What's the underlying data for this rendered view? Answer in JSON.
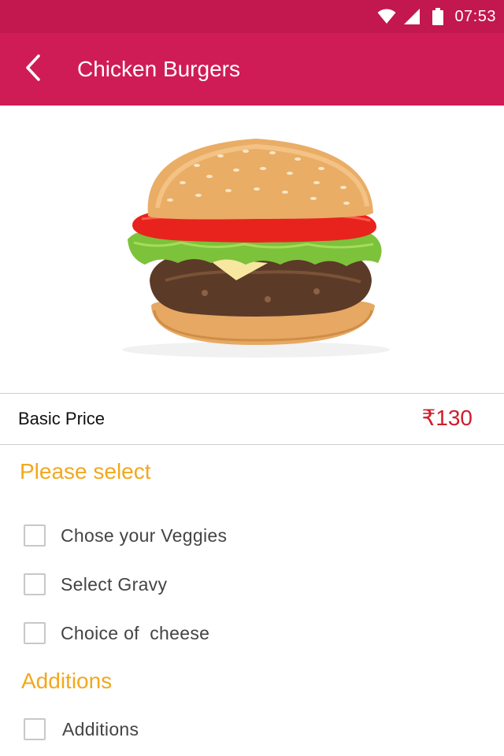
{
  "status_bar": {
    "time": "07:53",
    "icons": [
      "wifi-icon",
      "signal-icon",
      "battery-icon"
    ]
  },
  "header": {
    "title": "Chicken Burgers",
    "back_icon": "chevron-left-icon"
  },
  "colors": {
    "status_bar": "#c2174f",
    "app_bar": "#d01c56",
    "price": "#d01c2a",
    "section_heading": "#f2a81d"
  },
  "product": {
    "image_subject": "burger",
    "price_label": "Basic Price",
    "price_value": "₹130"
  },
  "sections": {
    "please_select": {
      "heading": "Please select",
      "options": [
        {
          "label": "Chose your Veggies",
          "checked": false
        },
        {
          "label": "Select Gravy",
          "checked": false
        },
        {
          "label": "Choice of  cheese",
          "checked": false
        }
      ]
    },
    "additions": {
      "heading": "Additions",
      "options": [
        {
          "label": "Additions",
          "checked": false
        }
      ]
    }
  }
}
